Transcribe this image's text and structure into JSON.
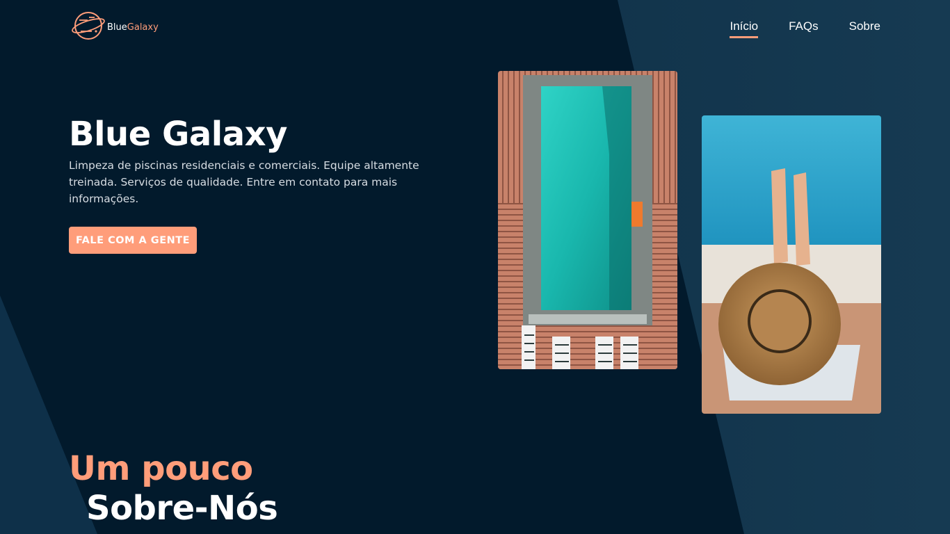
{
  "brand": {
    "name_part1": "Blue",
    "name_part2": "Galaxy",
    "logo_icon": "planet-icon",
    "accent_color": "#ff9d7a"
  },
  "nav": {
    "items": [
      {
        "label": "Início",
        "active": true
      },
      {
        "label": "FAQs",
        "active": false
      },
      {
        "label": "Sobre",
        "active": false
      }
    ]
  },
  "hero": {
    "title": "Blue Galaxy",
    "description": "Limpeza de piscinas residenciais e comerciais. Equipe altamente treinada. Serviços de qualidade. Entre em contato para mais informações.",
    "cta_label": "FALE COM A GENTE"
  },
  "about": {
    "line1": "Um pouco",
    "line2": "Sobre-Nós"
  },
  "colors": {
    "background": "#021a2c",
    "panel": "#163a52"
  }
}
